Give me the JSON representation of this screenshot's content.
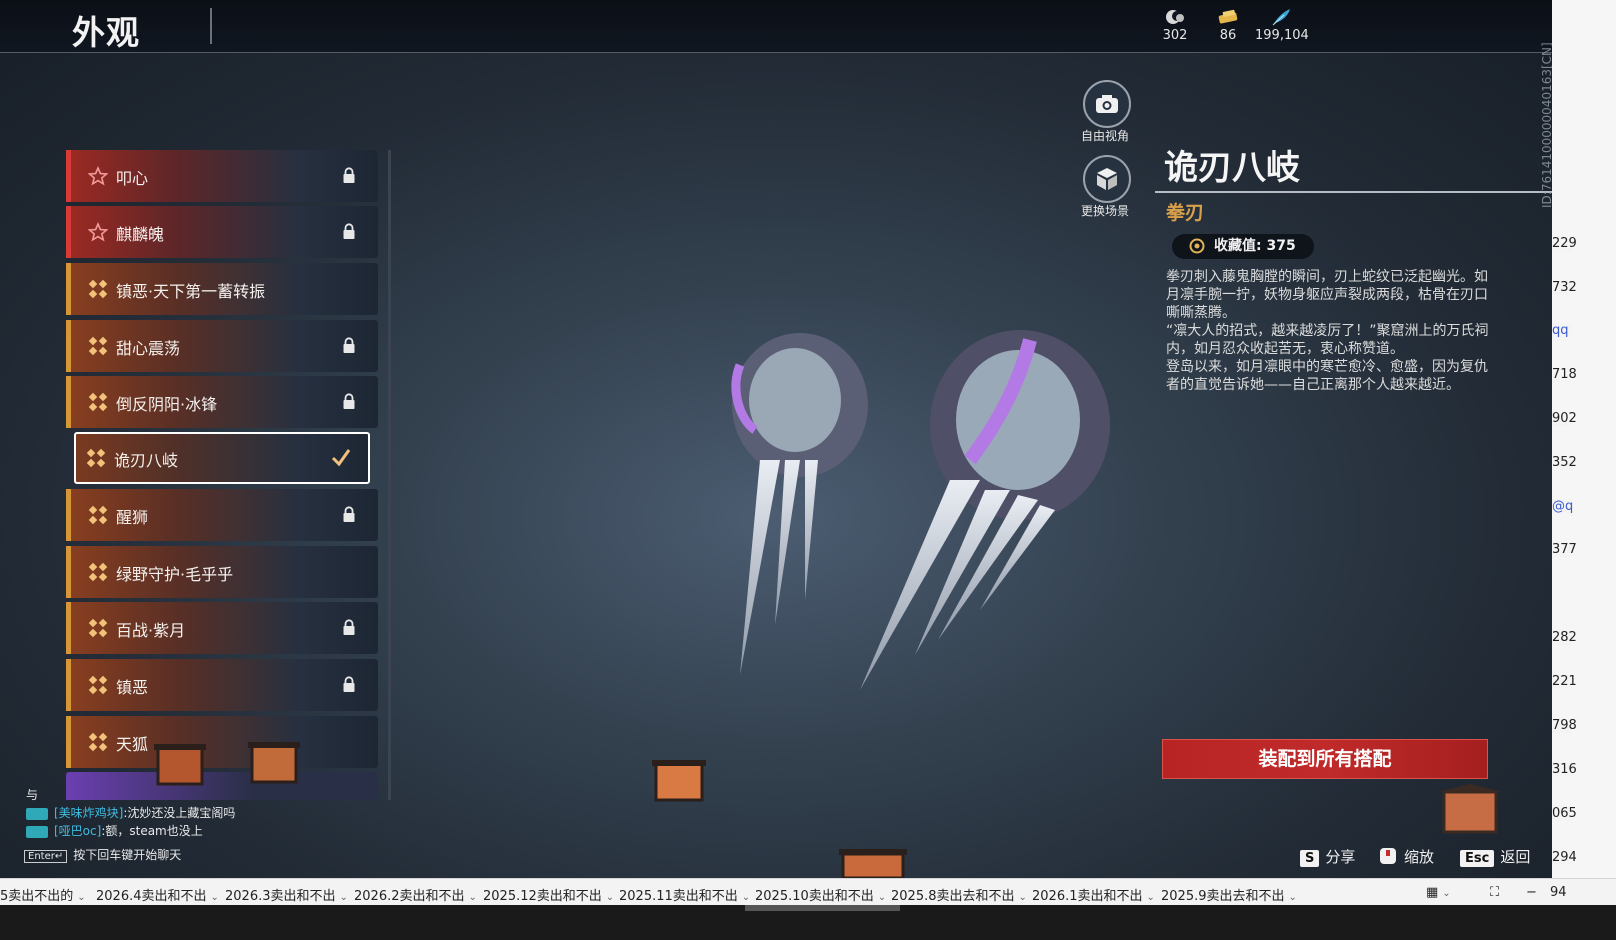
{
  "header": {
    "title": "外观"
  },
  "currencies": [
    {
      "icon": "moon-shell-icon",
      "value": "302"
    },
    {
      "icon": "gold-ticket-icon",
      "value": "86"
    },
    {
      "icon": "feather-icon",
      "value": "199,104"
    }
  ],
  "list": [
    {
      "label": "叩心",
      "tier": "red",
      "icon": "star-icon",
      "locked": true,
      "selected": false
    },
    {
      "label": "麒麟魄",
      "tier": "red",
      "icon": "star-icon",
      "locked": true,
      "selected": false
    },
    {
      "label": "镇恶·天下第一蓄转振",
      "tier": "gold",
      "icon": "cross-icon",
      "locked": false,
      "selected": false
    },
    {
      "label": "甜心震荡",
      "tier": "gold",
      "icon": "cross-icon",
      "locked": true,
      "selected": false
    },
    {
      "label": "倒反阴阳·冰锋",
      "tier": "gold",
      "icon": "cross-icon",
      "locked": true,
      "selected": false
    },
    {
      "label": "诡刃八岐",
      "tier": "gold",
      "icon": "cross-icon",
      "locked": false,
      "selected": true
    },
    {
      "label": "醒狮",
      "tier": "gold",
      "icon": "cross-icon",
      "locked": true,
      "selected": false
    },
    {
      "label": "绿野守护·毛乎乎",
      "tier": "gold",
      "icon": "cross-icon",
      "locked": false,
      "selected": false
    },
    {
      "label": "百战·紫月",
      "tier": "gold",
      "icon": "cross-icon",
      "locked": true,
      "selected": false
    },
    {
      "label": "镇恶",
      "tier": "gold",
      "icon": "cross-icon",
      "locked": true,
      "selected": false
    },
    {
      "label": "天狐",
      "tier": "gold",
      "icon": "cross-icon",
      "locked": false,
      "selected": false
    }
  ],
  "view_buttons": {
    "free_camera": "自由视角",
    "change_scene": "更换场景"
  },
  "detail": {
    "name": "诡刃八岐",
    "category": "拳刃",
    "collect_label": "收藏值: 375",
    "description": [
      "拳刃刺入藤鬼胸膛的瞬间，刃上蛇纹已泛起幽光。如月凛手腕一拧，妖物身躯应声裂成两段，枯骨在刃口嘶嘶蒸腾。",
      "“凛大人的招式，越来越凌厉了！”聚窟洲上的万氏祠内，如月忍众收起苦无，衷心称赞道。",
      "登岛以来，如月凛眼中的寒芒愈冷、愈盛，因为复仇者的直觉告诉她——自己正离那个人越来越近。"
    ],
    "equip_button": "装配到所有搭配"
  },
  "hotkeys": [
    {
      "key": "S",
      "label": "分享"
    },
    {
      "key": "",
      "label": "缩放",
      "icon": "mouse-icon"
    },
    {
      "key": "Esc",
      "label": "返回"
    }
  ],
  "chat": {
    "partial_line": "与",
    "messages": [
      {
        "name": "[美味炸鸡块]",
        "text": ":沈妙还没上藏宝阁吗"
      },
      {
        "name": "[哑巴oc]",
        "text": ":额，steam也没上"
      }
    ],
    "enter_key": "Enter↵",
    "enter_hint": "按下回车键开始聊天"
  },
  "side_id": "ID:7614100000040163[CN]",
  "edge_numbers": [
    "229",
    "732",
    "qq",
    "718",
    "902",
    "352",
    "@q",
    "377",
    "282",
    "221",
    "798",
    "316",
    "065",
    "294"
  ],
  "taskbar": {
    "tabs": [
      "5卖出不出的",
      "2026.4卖出和不出",
      "2026.3卖出和不出",
      "2026.2卖出和不出",
      "2025.12卖出和不出",
      "2025.11卖出和不出",
      "2025.10卖出和不出",
      "2025.8卖出去和不出",
      "2026.1卖出和不出",
      "2025.9卖出去和不出"
    ],
    "zoom": "94"
  }
}
